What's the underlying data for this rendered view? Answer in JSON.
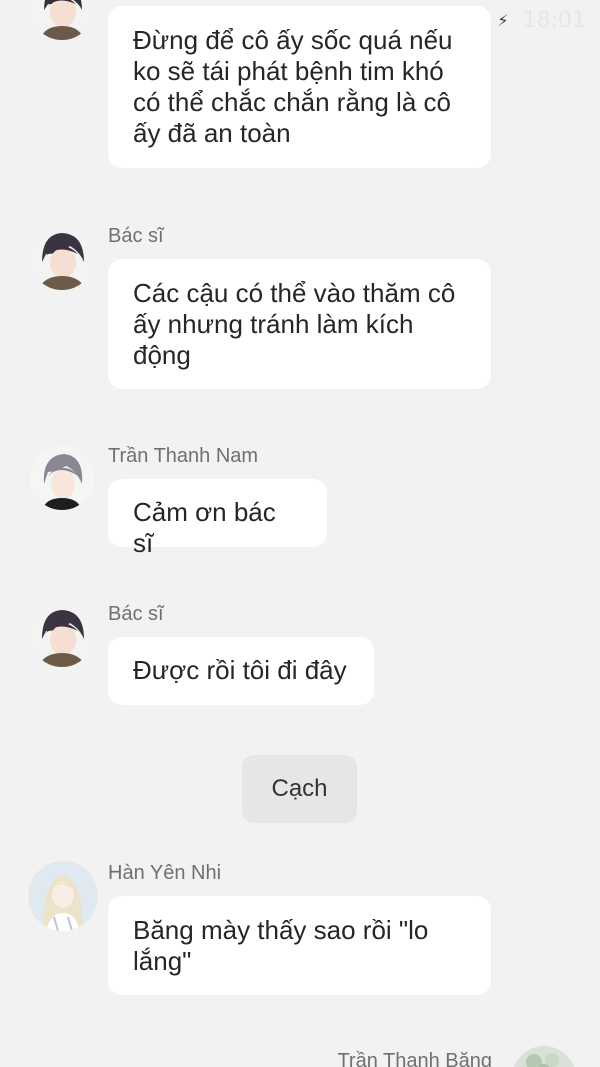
{
  "status_bar": {
    "time": "18:01",
    "charging_icon": "bolt-icon"
  },
  "messages": [
    {
      "sender": "",
      "text": "Đừng để cô ấy sốc quá nếu ko sẽ tái phát bệnh tim khó có thể chắc chắn rằng là cô ấy đã an toàn",
      "avatar": "doctor-avatar"
    },
    {
      "sender": "Bác sĩ",
      "text": "Các cậu có thể vào thăm cô ấy nhưng tránh làm kích động",
      "avatar": "doctor-avatar"
    },
    {
      "sender": "Trần Thanh Nam",
      "text": "Cảm ơn bác sĩ",
      "avatar": "nam-avatar"
    },
    {
      "sender": "Bác sĩ",
      "text": "Được rồi tôi đi đây",
      "avatar": "doctor-avatar"
    },
    {
      "sender": "Hàn Yên Nhi",
      "text": "Băng mày thấy sao rồi \"lo lắng\"",
      "avatar": "yen-nhi-avatar"
    }
  ],
  "action": {
    "label": "Cạch"
  },
  "next_sender": {
    "name": "Trần Thanh Băng",
    "avatar": "bang-avatar"
  },
  "colors": {
    "background": "#f2f2f2",
    "bubble": "#ffffff",
    "chip": "#e6e6e6",
    "text": "#262626",
    "sender": "#707070"
  }
}
